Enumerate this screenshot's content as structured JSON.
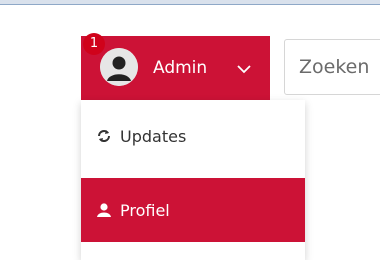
{
  "header": {
    "notification_count": "1",
    "user_name": "Admin"
  },
  "search": {
    "placeholder": "Zoeken"
  },
  "dropdown": {
    "items": [
      {
        "label": "Updates",
        "icon": "refresh-icon"
      },
      {
        "label": "Profiel",
        "icon": "user-icon"
      }
    ]
  },
  "colors": {
    "accent": "#cc1236",
    "badge": "#d0021b"
  }
}
